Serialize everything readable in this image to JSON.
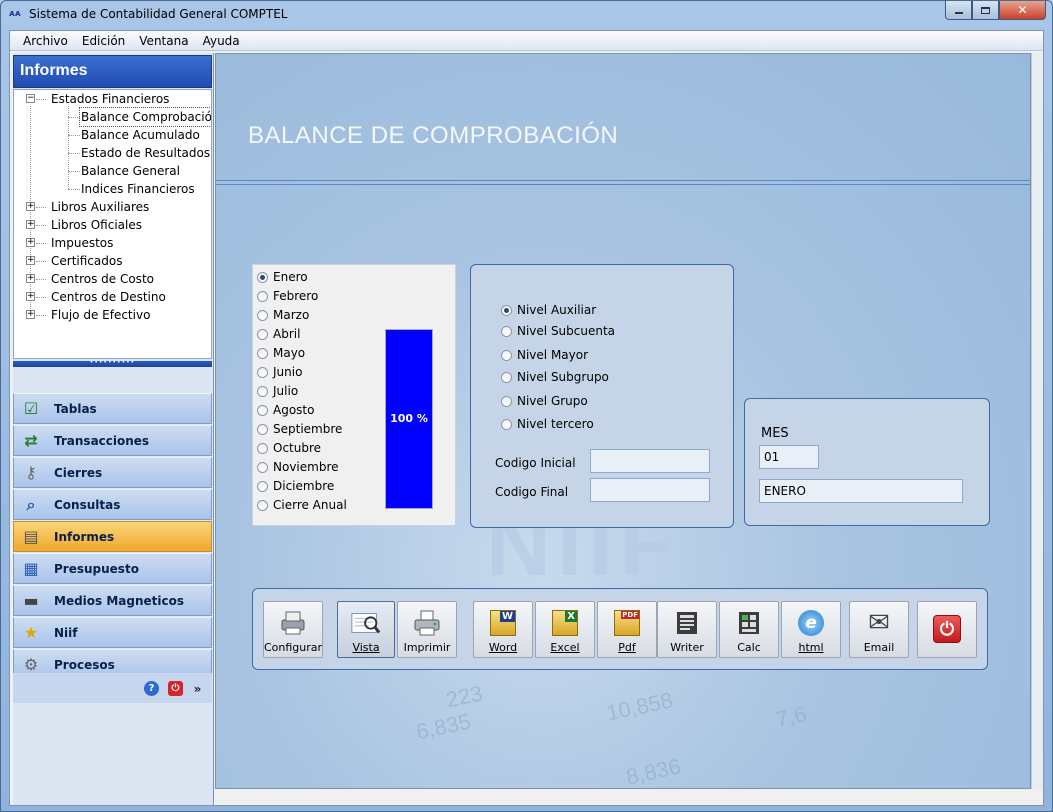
{
  "window": {
    "title": "Sistema de Contabilidad General COMPTEL",
    "app_icon": "ᴀᴀ",
    "min_icon": "minimize-icon",
    "max_icon": "maximize-icon",
    "close_icon": "close-icon",
    "close_glyph": "✕"
  },
  "menu": [
    "Archivo",
    "Edición",
    "Ventana",
    "Ayuda"
  ],
  "left": {
    "header": "Informes",
    "tree": {
      "root_open": "Estados Financieros",
      "children": [
        "Balance Comprobación",
        "Balance Acumulado",
        "Estado de Resultados",
        "Balance General",
        "Indices Financieros"
      ],
      "collapsed": [
        "Libros Auxiliares",
        "Libros Oficiales",
        "Impuestos",
        "Certificados",
        "Centros de Costo",
        "Centros de Destino",
        "Flujo de Efectivo"
      ]
    },
    "splitter_glyph": "••••••••••",
    "nav": [
      {
        "label": "Tablas",
        "icon": "checklist-icon",
        "glyph": "☑"
      },
      {
        "label": "Transacciones",
        "icon": "transfer-icon",
        "glyph": "⇄"
      },
      {
        "label": "Cierres",
        "icon": "keys-icon",
        "glyph": "⚷"
      },
      {
        "label": "Consultas",
        "icon": "magnifier-icon",
        "glyph": "⌕"
      },
      {
        "label": "Informes",
        "icon": "document-icon",
        "glyph": "▤"
      },
      {
        "label": "Presupuesto",
        "icon": "calculator-icon",
        "glyph": "▦"
      },
      {
        "label": "Medios Magneticos",
        "icon": "drive-icon",
        "glyph": "▬"
      },
      {
        "label": "Niif",
        "icon": "star-icon",
        "glyph": "★"
      },
      {
        "label": "Procesos",
        "icon": "gears-icon",
        "glyph": "⚙"
      }
    ],
    "footer": {
      "help_glyph": "?",
      "power_glyph": "⏻",
      "expand_glyph": "»"
    }
  },
  "main": {
    "title": "BALANCE DE COMPROBACIÓN",
    "watermark": "NIIF",
    "bg_numbers": [
      "223",
      "10,858",
      "6,835",
      "8,836",
      "7,6"
    ],
    "months": [
      "Enero",
      "Febrero",
      "Marzo",
      "Abril",
      "Mayo",
      "Junio",
      "Julio",
      "Agosto",
      "Septiembre",
      "Octubre",
      "Noviembre",
      "Diciembre",
      "Cierre Anual"
    ],
    "selected_month": "Enero",
    "progress": {
      "value": 1.0,
      "label": "100 %"
    },
    "levels": [
      "Nivel Auxiliar",
      "Nivel Subcuenta",
      "Nivel Mayor",
      "Nivel Subgrupo",
      "Nivel Grupo",
      "Nivel tercero"
    ],
    "selected_level": "Nivel Auxiliar",
    "codigo_inicial_label": "Codigo Inicial",
    "codigo_inicial_value": "",
    "codigo_final_label": "Codigo Final",
    "codigo_final_value": "",
    "mes_label": "MES",
    "mes_num": "01",
    "mes_name": "ENERO",
    "buttons": [
      {
        "label": "Configurar",
        "icon": "printer-config-icon"
      },
      {
        "label": "Vista",
        "icon": "print-preview-icon"
      },
      {
        "label": "Imprimir",
        "icon": "printer-icon"
      },
      {
        "label": "Word",
        "icon": "word-icon",
        "glyph": "W"
      },
      {
        "label": "Excel",
        "icon": "excel-icon",
        "glyph": "X"
      },
      {
        "label": "Pdf",
        "icon": "pdf-icon",
        "glyph": "PDF"
      },
      {
        "label": "Writer",
        "icon": "writer-icon"
      },
      {
        "label": "Calc",
        "icon": "calc-icon"
      },
      {
        "label": "html",
        "icon": "html-icon",
        "glyph": "e"
      },
      {
        "label": "Email",
        "icon": "email-icon",
        "glyph": "✉"
      },
      {
        "label": "",
        "icon": "power-icon",
        "glyph": "⏻"
      }
    ]
  },
  "colors": {
    "accent": "#1f4db0",
    "progress": "#0000ff",
    "active_nav": "#f0a72e",
    "exit": "#d8232a"
  }
}
